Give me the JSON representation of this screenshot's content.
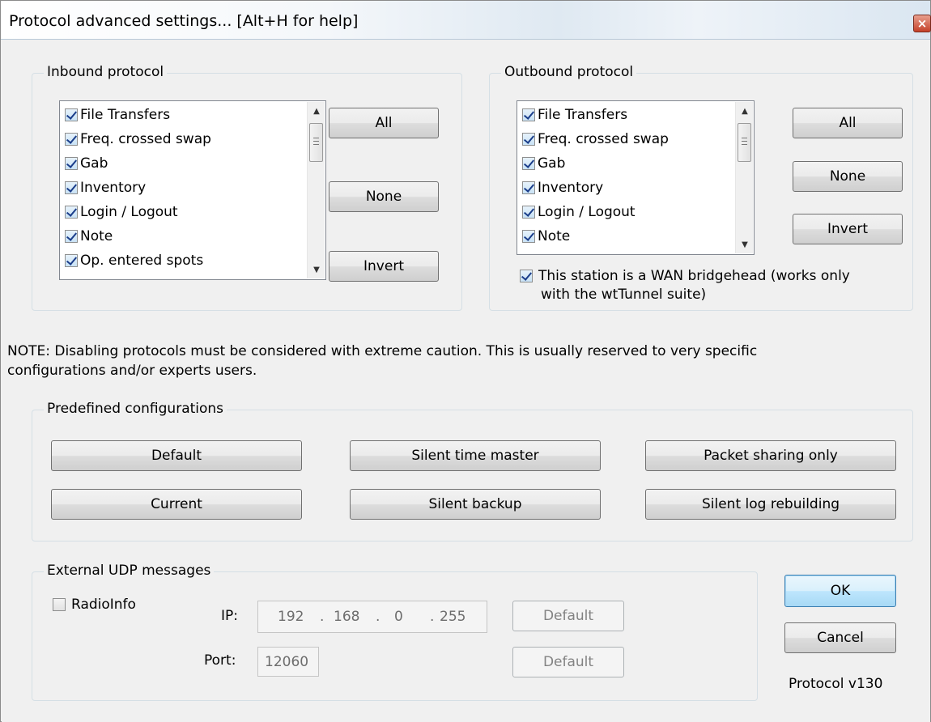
{
  "window": {
    "title": "Protocol advanced settings... [Alt+H for help]",
    "close_glyph": "×"
  },
  "inbound": {
    "label": "Inbound protocol",
    "items": [
      {
        "label": "File Transfers",
        "checked": true
      },
      {
        "label": "Freq. crossed swap",
        "checked": true
      },
      {
        "label": "Gab",
        "checked": true
      },
      {
        "label": "Inventory",
        "checked": true
      },
      {
        "label": "Login / Logout",
        "checked": true
      },
      {
        "label": "Note",
        "checked": true
      },
      {
        "label": "Op. entered spots",
        "checked": true
      }
    ],
    "all_label": "All",
    "none_label": "None",
    "invert_label": "Invert"
  },
  "outbound": {
    "label": "Outbound protocol",
    "items": [
      {
        "label": "File Transfers",
        "checked": true
      },
      {
        "label": "Freq. crossed swap",
        "checked": true
      },
      {
        "label": "Gab",
        "checked": true
      },
      {
        "label": "Inventory",
        "checked": true
      },
      {
        "label": "Login / Logout",
        "checked": true
      },
      {
        "label": "Note",
        "checked": true
      }
    ],
    "all_label": "All",
    "none_label": "None",
    "invert_label": "Invert",
    "wan_checked": true,
    "wan_label_line1": "This station is a WAN bridgehead (works only",
    "wan_label_line2": "with  the wtTunnel suite)"
  },
  "note": {
    "line1": "NOTE: Disabling protocols must be considered with extreme caution. This is usually reserved to very specific",
    "line2": "configurations and/or experts users."
  },
  "predefined": {
    "label": "Predefined configurations",
    "default_label": "Default",
    "silent_time_master_label": "Silent time master",
    "packet_sharing_label": "Packet sharing only",
    "current_label": "Current",
    "silent_backup_label": "Silent backup",
    "silent_log_label": "Silent log rebuilding"
  },
  "udp": {
    "label": "External UDP messages",
    "radioinfo_label": "RadioInfo",
    "radioinfo_checked": false,
    "ip_label": "IP:",
    "ip_octets": [
      "192",
      "168",
      "0",
      "255"
    ],
    "ip_dot": ".",
    "port_label": "Port:",
    "port_value": "12060",
    "ip_default_label": "Default",
    "port_default_label": "Default"
  },
  "footer": {
    "ok_label": "OK",
    "cancel_label": "Cancel",
    "version": "Protocol v130"
  },
  "icons": {
    "scroll_up": "▲",
    "scroll_down": "▼"
  }
}
